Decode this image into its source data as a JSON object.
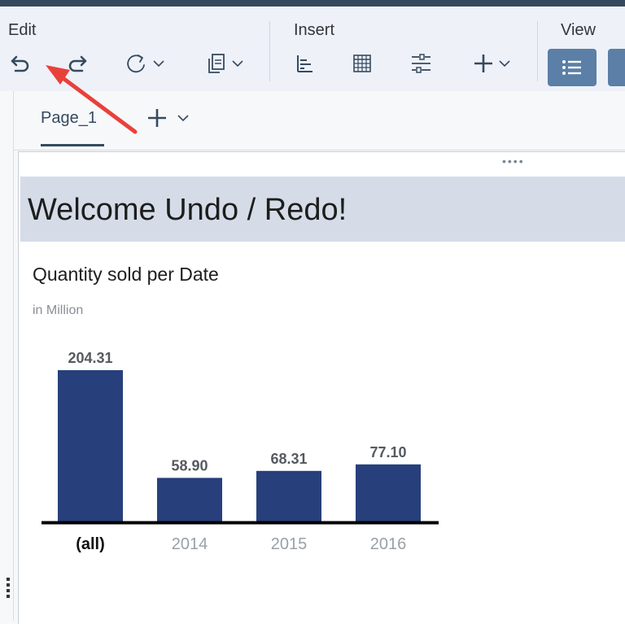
{
  "toolbar": {
    "groups": [
      {
        "label": "Edit"
      },
      {
        "label": "Insert"
      },
      {
        "label": "View"
      }
    ],
    "icons": {
      "undo": "undo-icon",
      "redo": "redo-icon",
      "refresh": "refresh-icon",
      "copy": "copy-icon",
      "chart": "bar-chart-icon",
      "table": "table-icon",
      "filter": "input-control-icon",
      "add": "plus-icon",
      "view_list": "list-icon"
    }
  },
  "tabs": {
    "items": [
      {
        "label": "Page_1"
      }
    ]
  },
  "story": {
    "header": "Welcome Undo / Redo!"
  },
  "chart_data": {
    "type": "bar",
    "title": "Quantity sold per Date",
    "subtitle": "in Million",
    "categories": [
      "(all)",
      "2014",
      "2015",
      "2016"
    ],
    "values": [
      204.31,
      58.9,
      68.31,
      77.1
    ],
    "value_labels": [
      "204.31",
      "58.90",
      "68.31",
      "77.10"
    ],
    "bar_color": "#27407b",
    "highlighted_category": "(all)"
  },
  "colors": {
    "accent": "#354a5f",
    "annotation_arrow": "#e8413a"
  }
}
